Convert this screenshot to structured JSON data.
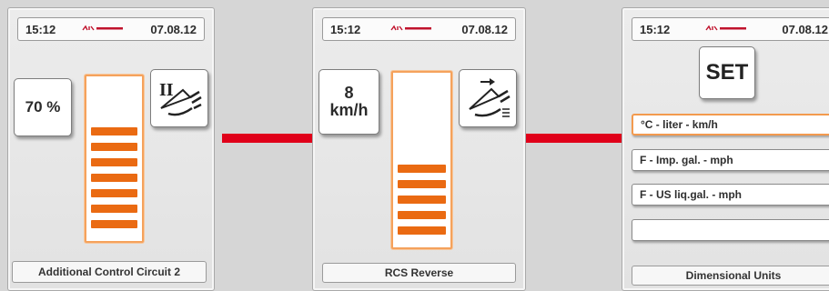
{
  "screens": [
    {
      "time": "15:12",
      "brand": "Tractor brand",
      "date": "07.08.12",
      "value": "70 %",
      "bar_level_segments": 7,
      "icon": "additional-control-circuit-icon",
      "footer": "Additional Control Circuit 2"
    },
    {
      "time": "15:12",
      "brand": "Tractor brand",
      "date": "07.08.12",
      "value_line1": "8",
      "value_line2": "km/h",
      "bar_level_segments": 5,
      "icon": "rcs-reverse-icon",
      "footer": "RCS Reverse"
    },
    {
      "time": "15:12",
      "brand": "Tractor brand",
      "date": "07.08.12",
      "set_label": "SET",
      "options": [
        "°C - liter - km/h",
        "F - Imp. gal. - mph",
        "F - US liq.gal. - mph",
        ""
      ],
      "selected_option": 0,
      "footer": "Dimensional Units"
    }
  ],
  "colors": {
    "accent": "#ea6a12",
    "connector": "#e0001a"
  }
}
